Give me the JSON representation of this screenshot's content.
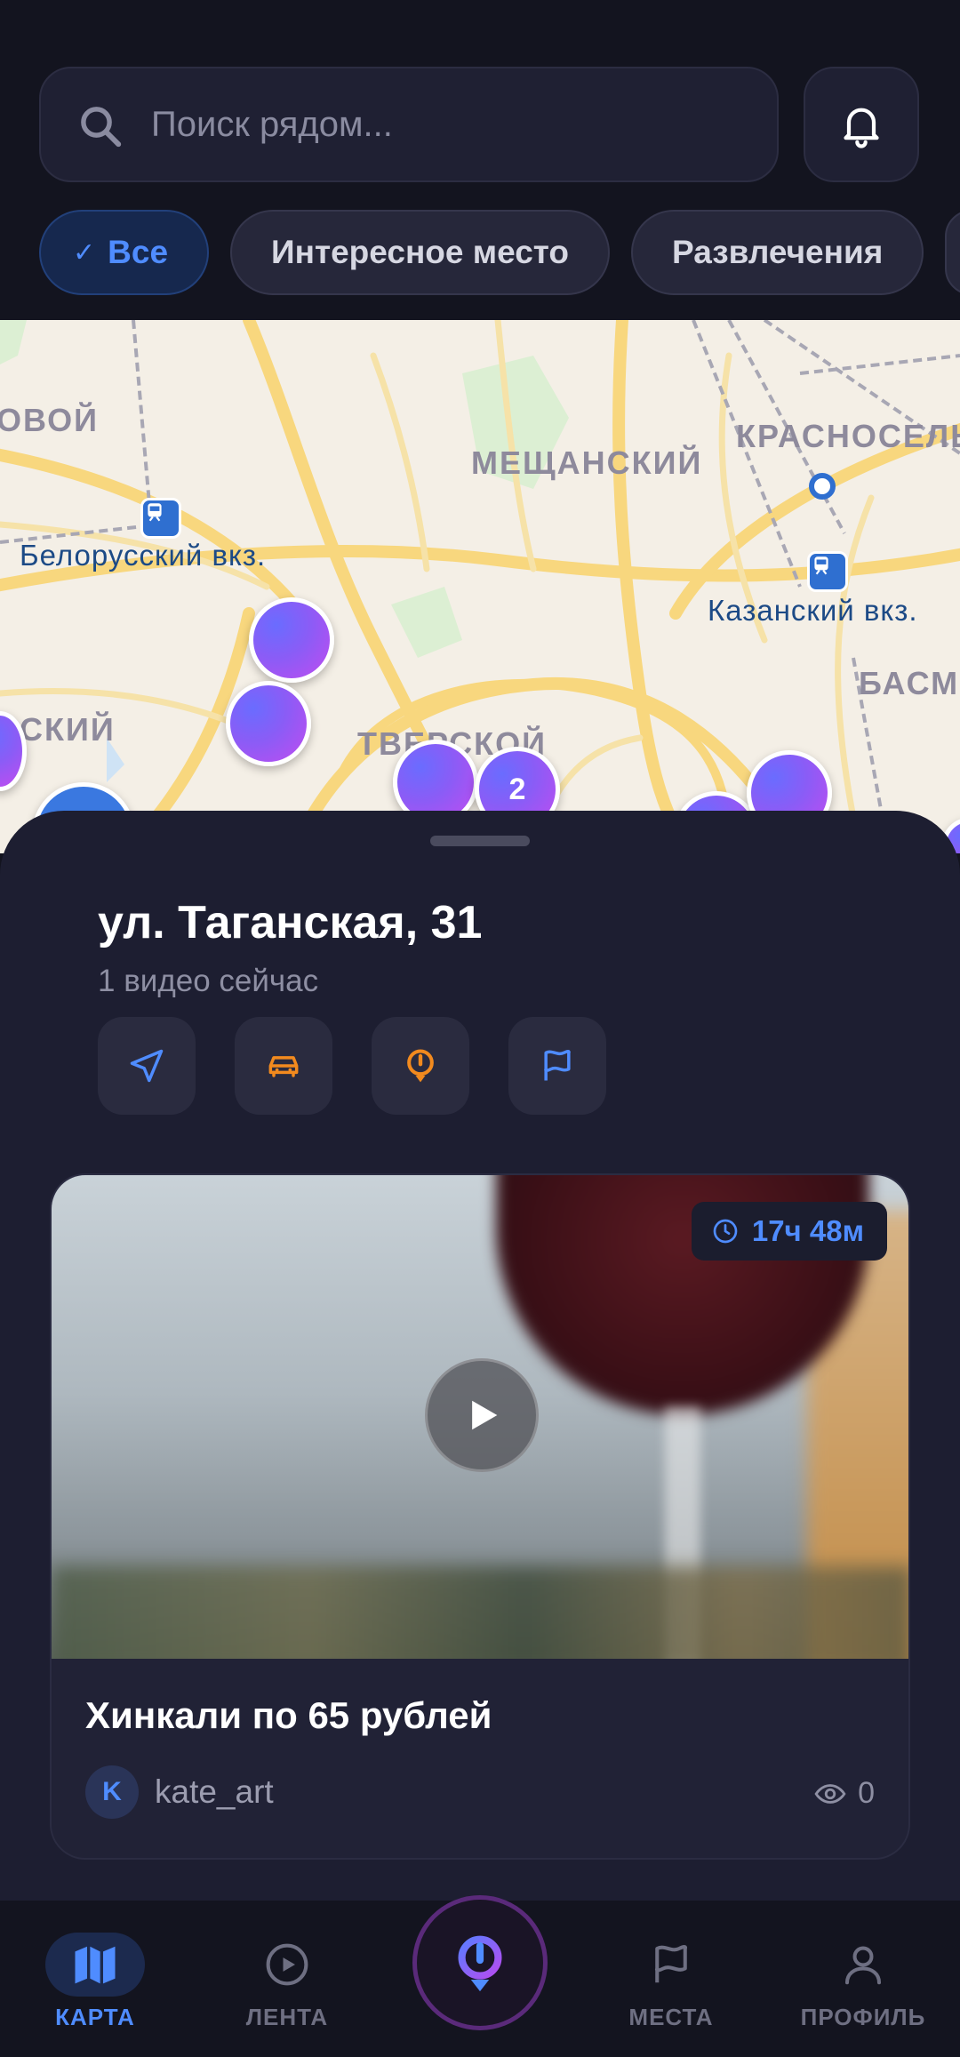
{
  "search": {
    "placeholder": "Поиск рядом..."
  },
  "filters": [
    {
      "label": "Все",
      "active": true
    },
    {
      "label": "Интересное место",
      "active": false
    },
    {
      "label": "Развлечения",
      "active": false
    }
  ],
  "map": {
    "districts": [
      "ОВОЙ",
      "МЕЩАНСКИЙ",
      "КРАСНОСЕЛЬ",
      "БАСМА",
      "СКИЙ",
      "ТВЕРСКОЙ"
    ],
    "stations": [
      "Белорусский вкз.",
      "Казанский вкз."
    ],
    "cluster_count": "2"
  },
  "place": {
    "title": "ул. Таганская, 31",
    "subtitle": "1 видео сейчас",
    "actions": [
      "navigate-icon",
      "car-icon",
      "pin-icon",
      "flag-icon"
    ]
  },
  "video": {
    "time_left": "17ч 48м",
    "title": "Хинкали по 65 рублей",
    "author_initial": "K",
    "author": "kate_art",
    "views": "0"
  },
  "nav": {
    "items": [
      {
        "label": "КАРТА",
        "icon": "map-icon",
        "active": true
      },
      {
        "label": "ЛЕНТА",
        "icon": "play-circle-icon",
        "active": false
      },
      {
        "label": "",
        "icon": "record-pin-icon",
        "active": false
      },
      {
        "label": "МЕСТА",
        "icon": "flag-icon",
        "active": false
      },
      {
        "label": "ПРОФИЛЬ",
        "icon": "user-icon",
        "active": false
      }
    ]
  },
  "colors": {
    "accent": "#4f8cff",
    "orange": "#f28a1e",
    "background": "#13141f",
    "sheet": "#1d1e31"
  }
}
